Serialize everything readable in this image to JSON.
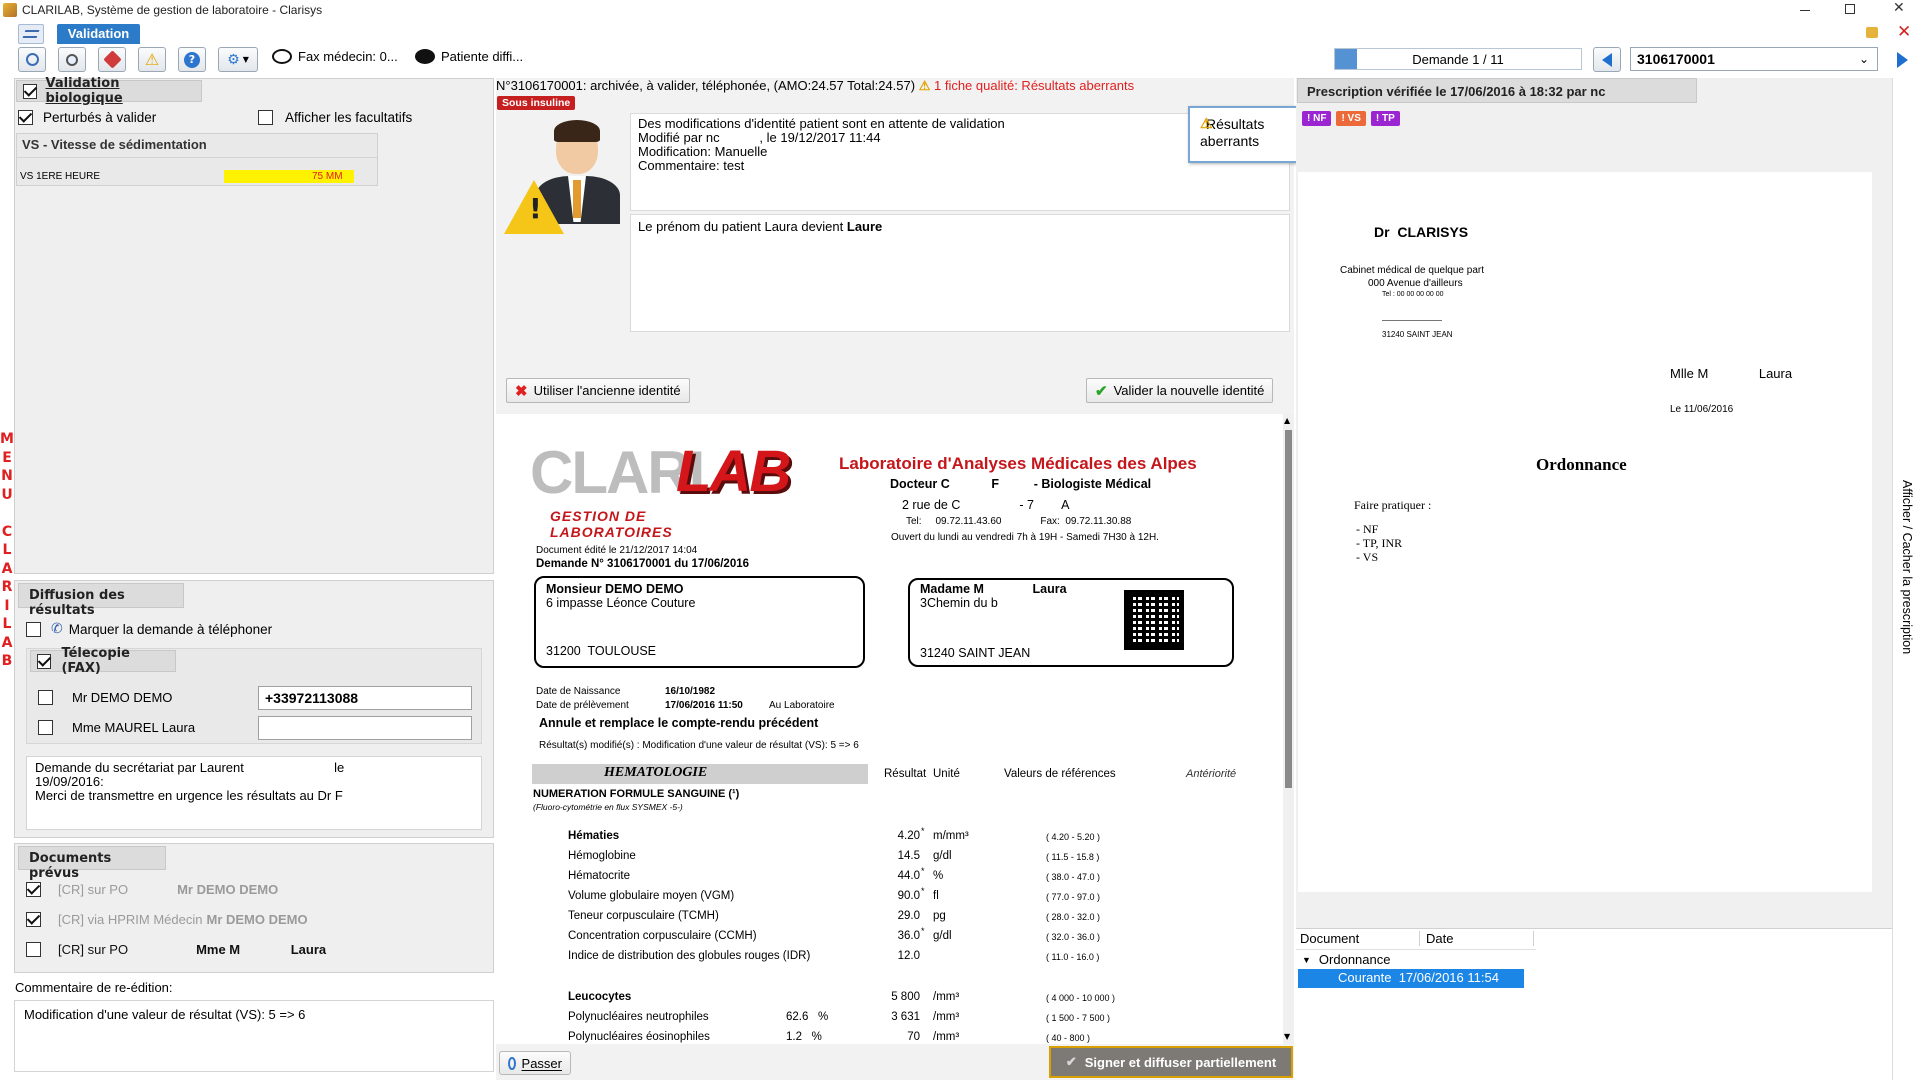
{
  "window": {
    "title": "CLARILAB, Système de gestion de laboratoire - Clarisys"
  },
  "ribbon": {
    "tab": "Validation"
  },
  "toolbar": {
    "fax_label": "Fax médecin: 0...",
    "patient_label": "Patiente diffi..."
  },
  "nav": {
    "demand_label": "Demande 1 / 11",
    "demand_number": "3106170001"
  },
  "side_menu": {
    "letters": [
      "M",
      "E",
      "N",
      "U",
      "",
      "C",
      "L",
      "A",
      "R",
      "I",
      "L",
      "A",
      "B"
    ]
  },
  "left": {
    "validation_header": "Validation biologique",
    "perturbed_label": "Perturbés à valider",
    "optional_label": "Afficher les facultatifs",
    "vs_title": "VS - Vitesse de sédimentation",
    "vs_row_label": "VS 1ERE HEURE",
    "vs_row_value": "75 MM",
    "diffusion_header": "Diffusion des résultats",
    "phone_label": "Marquer la demande à téléphoner",
    "fax_header": "Télecopie (FAX)",
    "fax_rows": [
      {
        "name": "Mr DEMO DEMO",
        "number": "+33972113088"
      },
      {
        "name": "Mme MAUREL Laura",
        "number": ""
      }
    ],
    "secretary_note": [
      "Demande du secrétariat par Laurent                         le",
      "19/09/2016:",
      "Merci de transmettre en urgence les résultats au Dr F"
    ],
    "docs_header": "Documents prévus",
    "docs": [
      {
        "checked": true,
        "type": "[CR] sur PO",
        "dest": "Mr DEMO DEMO",
        "active": false
      },
      {
        "checked": true,
        "type": "[CR] via HPRIM Médecin",
        "dest": "Mr DEMO DEMO",
        "active": false
      },
      {
        "checked": false,
        "type": "[CR] sur PO",
        "dest": "Mme M              Laura",
        "active": true
      }
    ],
    "reedit_label": "Commentaire de re-édition:",
    "reedit_text": "Modification d'une valeur de résultat (VS): 5 => 6"
  },
  "center": {
    "status_text": "N°3106170001: archivée, à valider,  téléphonée, (AMO:24.57 Total:24.57)",
    "quality_text": "1 fiche qualité: Résultats aberrants",
    "insulin_badge": "Sous insuline",
    "identity_notice": [
      "Des modifications d'identité patient sont en attente de validation",
      "Modifié par nc           , le 19/12/2017 11:44",
      "Modification: Manuelle",
      "Commentaire: test"
    ],
    "name_change_prefix": "Le prénom du patient Laura devient ",
    "name_change_bold": "Laure",
    "aberrant_label": "Résultats aberrants",
    "old_identity_button": "Utiliser l'ancienne identité",
    "new_identity_button": "Valider la nouvelle identité",
    "pass_button": "Passer",
    "sign_button": "Signer et diffuser partiellement"
  },
  "report": {
    "logo_clari": "CLARI",
    "logo_lab": "LAB",
    "logo_sub": "GESTION DE LABORATOIRES",
    "lab_name": "Laboratoire d'Analyses Médicales des Alpes",
    "doctor": "Docteur C            F          - Biologiste Médical",
    "address": "2 rue de C                 - 7        A",
    "phones": "Tel:     09.72.11.43.60              Fax:  09.72.11.30.88",
    "hours": "Ouvert du lundi au vendredi 7h à 19H - Samedi 7H30 à 12H.",
    "edited": "Document édité le   21/12/2017 14:04",
    "demand": "Demande N° 3106170001 du 17/06/2016",
    "doctor_box": {
      "name": "Monsieur DEMO DEMO",
      "street": "6 impasse Léonce Couture",
      "city": "31200  TOULOUSE"
    },
    "patient_box": {
      "name": "Madame M              Laura",
      "street": "3Chemin du b",
      "city": "31240 SAINT JEAN"
    },
    "birth_label": "Date de Naissance",
    "birth_value": "16/10/1982",
    "sample_label": "Date de prélèvement",
    "sample_value": "17/06/2016 11:50",
    "sample_place": "Au Laboratoire",
    "cancel_text": "Annule et remplace le compte-rendu précédent",
    "modified_text": "Résultat(s) modifié(s) : Modification d'une valeur de résultat (VS): 5 => 6",
    "section": "HEMATOLOGIE",
    "col_result": "Résultat",
    "col_unit": "Unité",
    "col_ref": "Valeurs de références",
    "col_prev": "Antériorité",
    "nfs_title": "NUMERATION FORMULE SANGUINE (¹)",
    "nfs_sub": "(Fluoro-cytométrie en flux SYSMEX -5-)",
    "rows": [
      {
        "label": "Hématies",
        "bold": true,
        "pct": "",
        "value": "4.20",
        "star": "*",
        "unit": "m/mm³",
        "ref": "( 4.20 - 5.20 )"
      },
      {
        "label": "Hémoglobine",
        "bold": false,
        "pct": "",
        "value": "14.5",
        "star": "",
        "unit": "g/dl",
        "ref": "( 11.5 - 15.8 )"
      },
      {
        "label": "Hématocrite",
        "bold": false,
        "pct": "",
        "value": "44.0",
        "star": "*",
        "unit": "%",
        "ref": "( 38.0 - 47.0 )"
      },
      {
        "label": "Volume globulaire moyen (VGM)",
        "bold": false,
        "pct": "",
        "value": "90.0",
        "star": "*",
        "unit": "fl",
        "ref": "( 77.0 - 97.0 )"
      },
      {
        "label": "Teneur corpusculaire (TCMH)",
        "bold": false,
        "pct": "",
        "value": "29.0",
        "star": "",
        "unit": "pg",
        "ref": "( 28.0 - 32.0 )"
      },
      {
        "label": "Concentration corpusculaire (CCMH)",
        "bold": false,
        "pct": "",
        "value": "36.0",
        "star": "*",
        "unit": "g/dl",
        "ref": "( 32.0 - 36.0 )"
      },
      {
        "label": "Indice de distribution des globules rouges (IDR)",
        "bold": false,
        "pct": "",
        "value": "12.0",
        "star": "",
        "unit": "",
        "ref": "( 11.0 - 16.0 )"
      },
      {
        "label": "Leucocytes",
        "bold": true,
        "pct": "",
        "value": "5 800",
        "star": "",
        "unit": "/mm³",
        "ref": "( 4 000 - 10 000 )"
      },
      {
        "label": "Polynucléaires neutrophiles",
        "bold": false,
        "pct": "62.6   %",
        "value": "3 631",
        "star": "",
        "unit": "/mm³",
        "ref": "( 1 500 - 7 500 )"
      },
      {
        "label": "Polynucléaires éosinophiles",
        "bold": false,
        "pct": "1.2   %",
        "value": "70",
        "star": "",
        "unit": "/mm³",
        "ref": "( 40 - 800 )"
      }
    ]
  },
  "right": {
    "header": "Prescription vérifiée le 17/06/2016 à 18:32 par nc",
    "tags": [
      {
        "label": "! NF",
        "color": "#9b26d1"
      },
      {
        "label": "! VS",
        "color": "#ec6a3a"
      },
      {
        "label": "! TP",
        "color": "#9b26d1"
      }
    ],
    "prescription": {
      "doctor": "Dr  CLARISYS",
      "cab1": "Cabinet médical de quelque part",
      "cab2": "000 Avenue d'ailleurs",
      "cab3": "Tel : 00 00 00 00 00",
      "cab4": "31240 SAINT JEAN",
      "patient": "Mlle M              Laura",
      "date": "Le 11/06/2016",
      "title": "Ordonnance",
      "instr": "Faire pratiquer :",
      "items": [
        "- NF",
        "- TP, INR",
        "- VS"
      ]
    },
    "toggle_label": "Afficher / Cacher la prescription",
    "doc_col": "Document",
    "date_col": "Date",
    "tree_parent": "Ordonnance",
    "tree_child": "Courante  17/06/2016 11:54"
  }
}
